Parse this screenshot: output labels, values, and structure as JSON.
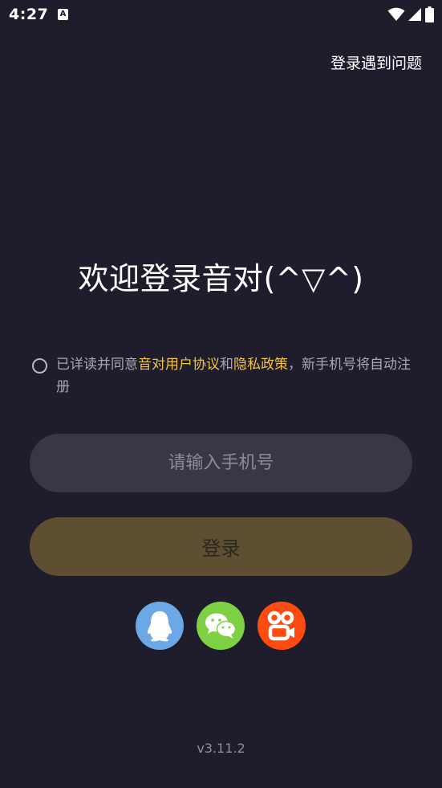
{
  "status_bar": {
    "time": "4:27",
    "notification_icon": "accessibility-a-icon",
    "icons": [
      "wifi-icon",
      "signal-icon",
      "battery-icon"
    ]
  },
  "header": {
    "help_label": "登录遇到问题"
  },
  "welcome": {
    "title": "欢迎登录音对(^▽^)"
  },
  "agreement": {
    "prefix": "已详读并同意",
    "user_agreement_label": "音对用户协议",
    "conjunction": "和",
    "privacy_policy_label": "隐私政策",
    "suffix": "，新手机号将自动注册",
    "checked": false
  },
  "phone": {
    "value": "",
    "placeholder": "请输入手机号"
  },
  "login": {
    "label": "登录"
  },
  "social": [
    {
      "name": "qq",
      "icon": "qq-penguin-icon",
      "color": "#6ca7e6"
    },
    {
      "name": "wechat",
      "icon": "wechat-icon",
      "color": "#7ed045"
    },
    {
      "name": "kuaishou",
      "icon": "kuaishou-icon",
      "color": "#fe4b10"
    }
  ],
  "footer": {
    "version": "v3.11.2"
  },
  "colors": {
    "background": "#1f1d2b",
    "accent_link": "#f2c24a",
    "input_bg": "#393744",
    "login_button_bg": "#5e4f32"
  }
}
